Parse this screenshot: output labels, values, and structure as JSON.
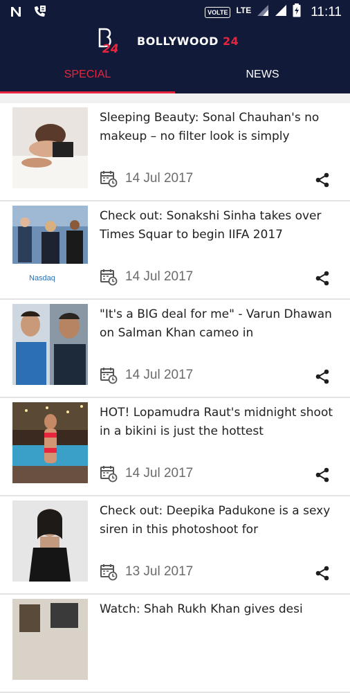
{
  "status_bar": {
    "volte": "VOLTE",
    "network": "LTE",
    "time": "11:11"
  },
  "app": {
    "brand_mark": "B24",
    "brand_name": "BOLLYWOOD",
    "brand_number": "24"
  },
  "tabs": [
    {
      "label": "SPECIAL",
      "selected": true
    },
    {
      "label": "NEWS",
      "selected": false
    }
  ],
  "colors": {
    "header": "#121a3a",
    "accent": "#e8253d"
  },
  "articles": [
    {
      "title": "Sleeping Beauty: Sonal Chauhan's no makeup – no filter look is simply",
      "date": "14 Jul 2017"
    },
    {
      "title": "Check out: Sonakshi Sinha takes over Times Squar to begin IIFA 2017",
      "date": "14 Jul 2017",
      "thumb_text": "Nasdaq"
    },
    {
      "title": "\"It's a BIG deal for me\" - Varun Dhawan on Salman Khan cameo in",
      "date": "14 Jul 2017"
    },
    {
      "title": "HOT! Lopamudra Raut's midnight shoot in a bikini is just the hottest",
      "date": "14 Jul 2017"
    },
    {
      "title": "Check out: Deepika Padukone is a sexy siren in this photoshoot for",
      "date": "13 Jul 2017"
    },
    {
      "title": "Watch: Shah Rukh Khan gives desi",
      "date": ""
    }
  ]
}
